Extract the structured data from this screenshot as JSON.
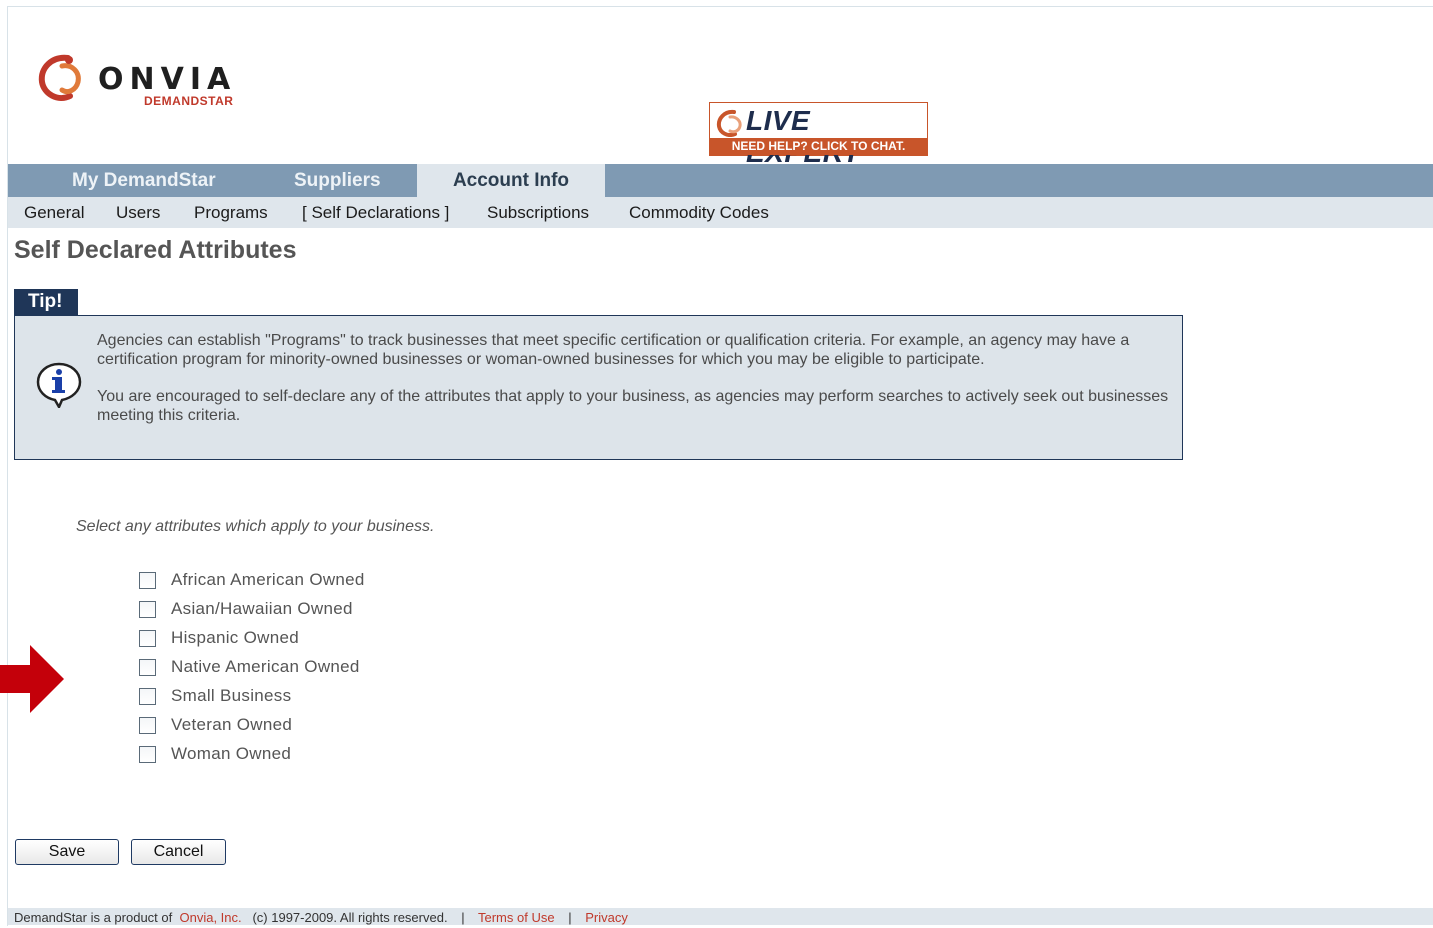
{
  "brand": {
    "name": "ONVIA",
    "subtitle": "DEMANDSTAR"
  },
  "live_expert": {
    "title": "LIVE EXPERT",
    "subtitle": "NEED HELP? CLICK TO CHAT."
  },
  "topnav": {
    "tabs": [
      {
        "label": "My DemandStar"
      },
      {
        "label": "Suppliers"
      },
      {
        "label": "Account Info",
        "active": true
      }
    ]
  },
  "subnav": {
    "items": [
      {
        "label": "General"
      },
      {
        "label": "Users"
      },
      {
        "label": "Programs"
      },
      {
        "label": "[ Self Declarations ]",
        "active": true
      },
      {
        "label": "Subscriptions"
      },
      {
        "label": "Commodity Codes"
      }
    ]
  },
  "page": {
    "title": "Self Declared Attributes"
  },
  "tip": {
    "label": "Tip!",
    "icon": "info-icon",
    "paragraph1": "Agencies can establish \"Programs\" to track businesses that meet specific certification or qualification criteria. For example, an agency may have a certification program for minority-owned businesses or woman-owned businesses for which you may be eligible to participate.",
    "paragraph2": "You are encouraged to self-declare any of the attributes that apply to your business, as agencies may perform searches to actively seek out businesses meeting this criteria."
  },
  "form": {
    "instruction": "Select any attributes which apply to your business.",
    "attributes": [
      {
        "label": "African American Owned",
        "checked": false
      },
      {
        "label": "Asian/Hawaiian Owned",
        "checked": false
      },
      {
        "label": "Hispanic Owned",
        "checked": false
      },
      {
        "label": "Native American Owned",
        "checked": false
      },
      {
        "label": "Small Business",
        "checked": false
      },
      {
        "label": "Veteran Owned",
        "checked": false
      },
      {
        "label": "Woman Owned",
        "checked": false
      }
    ],
    "save_label": "Save",
    "cancel_label": "Cancel"
  },
  "footer": {
    "text1": "DemandStar is a product of",
    "company_link": "Onvia, Inc.",
    "text2": "(c) 1997-2009. All rights reserved.",
    "sep": "|",
    "terms_link": "Terms of Use",
    "privacy_link": "Privacy"
  },
  "colors": {
    "nav_bar": "#7f9ab3",
    "subnav_bar": "#dfe6ec",
    "tip_header": "#1f3658",
    "brand_accent": "#c0392b",
    "annotation_arrow": "#c4000a"
  }
}
